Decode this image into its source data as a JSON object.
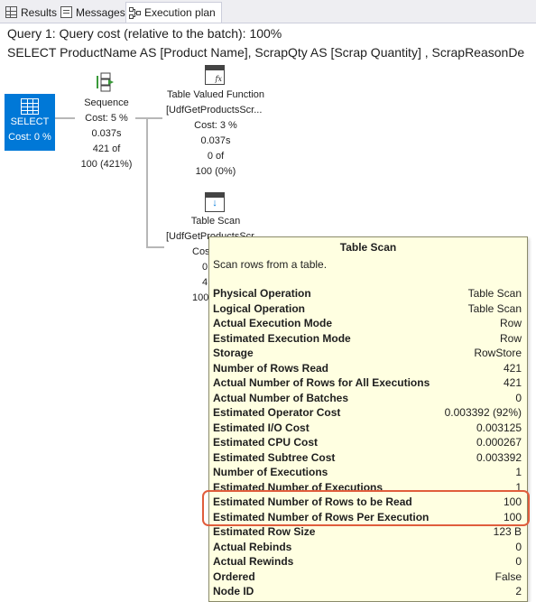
{
  "tabs": [
    {
      "label": "Results",
      "icon": "grid-icon"
    },
    {
      "label": "Messages",
      "icon": "messages-icon"
    },
    {
      "label": "Execution plan",
      "icon": "execution-plan-icon",
      "active": true
    }
  ],
  "query": {
    "cost_line": "Query 1: Query cost (relative to the batch): 100%",
    "sql_line": "SELECT ProductName AS [Product Name], ScrapQty AS [Scrap Quantity] , ScrapReasonDe"
  },
  "plan": {
    "select": {
      "name": "SELECT",
      "cost": "Cost: 0 %"
    },
    "sequence": {
      "name": "Sequence",
      "cost": "Cost: 5 %",
      "time": "0.037s",
      "rows_of": "421 of",
      "estimate": "100 (421%)"
    },
    "tvf": {
      "name": "Table Valued Function",
      "object": "[UdfGetProductsScr...",
      "cost": "Cost: 3 %",
      "time": "0.037s",
      "rows_of": "0 of",
      "estimate": "100 (0%)"
    },
    "table_scan": {
      "name": "Table Scan",
      "object": "[UdfGetProductsScr...",
      "cost_partial": "Cos",
      "time_partial": "0.",
      "rows_partial": "4.",
      "estimate_partial": "100"
    }
  },
  "tooltip": {
    "title": "Table Scan",
    "description": "Scan rows from a table.",
    "rows": [
      {
        "label": "Physical Operation",
        "value": "Table Scan"
      },
      {
        "label": "Logical Operation",
        "value": "Table Scan"
      },
      {
        "label": "Actual Execution Mode",
        "value": "Row"
      },
      {
        "label": "Estimated Execution Mode",
        "value": "Row"
      },
      {
        "label": "Storage",
        "value": "RowStore"
      },
      {
        "label": "Number of Rows Read",
        "value": "421"
      },
      {
        "label": "Actual Number of Rows for All Executions",
        "value": "421"
      },
      {
        "label": "Actual Number of Batches",
        "value": "0"
      },
      {
        "label": "Estimated Operator Cost",
        "value": "0.003392 (92%)"
      },
      {
        "label": "Estimated I/O Cost",
        "value": "0.003125"
      },
      {
        "label": "Estimated CPU Cost",
        "value": "0.000267"
      },
      {
        "label": "Estimated Subtree Cost",
        "value": "0.003392"
      },
      {
        "label": "Number of Executions",
        "value": "1"
      },
      {
        "label": "Estimated Number of Executions",
        "value": "1"
      },
      {
        "label": "Estimated Number of Rows to be Read",
        "value": "100"
      },
      {
        "label": "Estimated Number of Rows Per Execution",
        "value": "100"
      },
      {
        "label": "Estimated Row Size",
        "value": "123 B"
      },
      {
        "label": "Actual Rebinds",
        "value": "0"
      },
      {
        "label": "Actual Rewinds",
        "value": "0"
      },
      {
        "label": "Ordered",
        "value": "False"
      },
      {
        "label": "Node ID",
        "value": "2"
      }
    ]
  },
  "colors": {
    "highlight": "#e05d3c",
    "selected_node": "#0078d7",
    "tooltip_bg": "#ffffe1"
  }
}
